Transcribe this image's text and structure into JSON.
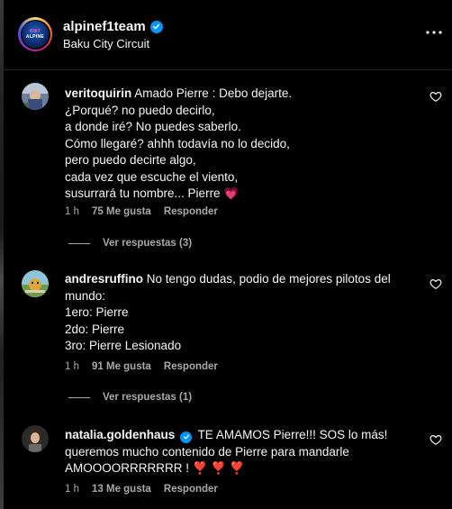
{
  "post": {
    "account": "alpinef1team",
    "location": "Baku City Circuit",
    "avatar_text_top": "BWT",
    "avatar_text_mid": "ALPINE",
    "verified": true
  },
  "comments": [
    {
      "username": "veritoquirin",
      "text": "Amado Pierre : Debo dejarte.\n¿Porqué? no puedo decirlo,\na donde iré? No puedes saberlo.\nCómo llegaré? ahhh todavía no lo decido,\npero puedo decirte algo,\ncada vez que escuche el viento,\nsusurrará tu nombre... Pierre 💗",
      "time": "1 h",
      "likes": "75 Me gusta",
      "reply_label": "Responder",
      "view_replies": "Ver respuestas (3)"
    },
    {
      "username": "andresruffino",
      "text": "No tengo dudas, podio de mejores pilotos del mundo:\n1ero: Pierre\n2do: Pierre\n3ro: Pierre Lesionado",
      "time": "1 h",
      "likes": "91 Me gusta",
      "reply_label": "Responder",
      "view_replies": "Ver respuestas (1)"
    },
    {
      "username": "natalia.goldenhaus",
      "verified": true,
      "text": "TE AMAMOS Pierre!!! SOS lo más! queremos mucho contenido de Pierre para mandarle AMOOOORRRRRRR ! ❣️ ❣️ ❣️",
      "time": "1 h",
      "likes": "13 Me gusta",
      "reply_label": "Responder"
    }
  ],
  "colors": {
    "background": "#000000",
    "text": "#f5f5f5",
    "muted": "#a8a8a8",
    "verified": "#0095f6",
    "heart": "#ff3d7f"
  },
  "icons": [
    "more-options-icon",
    "verified-badge-icon",
    "heart-outline-icon"
  ]
}
